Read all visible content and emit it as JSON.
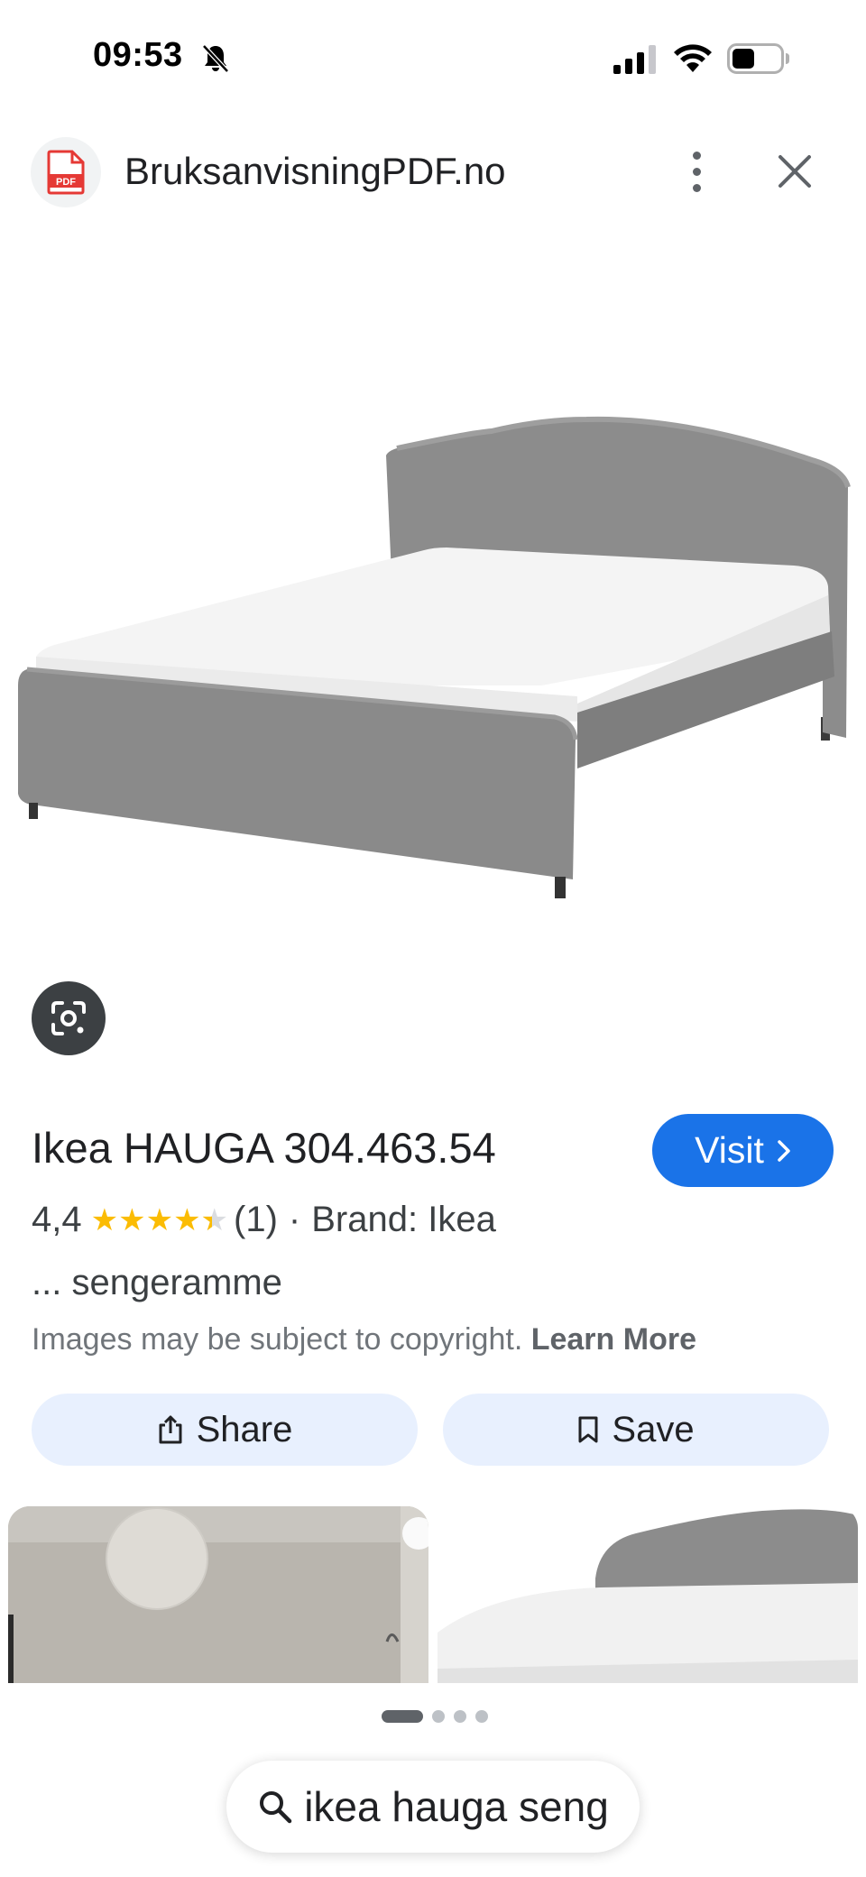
{
  "status_bar": {
    "time": "09:53"
  },
  "header": {
    "site_name": "BruksanvisningPDF.no",
    "logo_text": "PDF"
  },
  "product": {
    "title": "Ikea HAUGA 304.463.54",
    "visit_label": "Visit",
    "rating_value": "4,4",
    "rating_fraction": 0.88,
    "review_count": "(1)",
    "separator": "·",
    "brand": "Brand: Ikea",
    "description": "... sengeramme",
    "copyright_text": "Images may be subject to copyright.",
    "learn_more": "Learn More"
  },
  "actions": {
    "share_label": "Share",
    "save_label": "Save"
  },
  "pager": {
    "total": 4,
    "active_index": 0
  },
  "search": {
    "query": "ikea hauga seng"
  },
  "colors": {
    "accent": "#1a73e8",
    "action_bg": "#e8f0fe",
    "star": "#fbbc04",
    "bed_fabric": "#8a8a8a",
    "pdf_red": "#e53935"
  },
  "icons": [
    "bell-muted-icon",
    "signal-icon",
    "wifi-icon",
    "battery-icon",
    "pdf-icon",
    "more-vert-icon",
    "close-icon",
    "google-lens-icon",
    "chevron-right-icon",
    "share-icon",
    "bookmark-icon",
    "search-icon"
  ]
}
